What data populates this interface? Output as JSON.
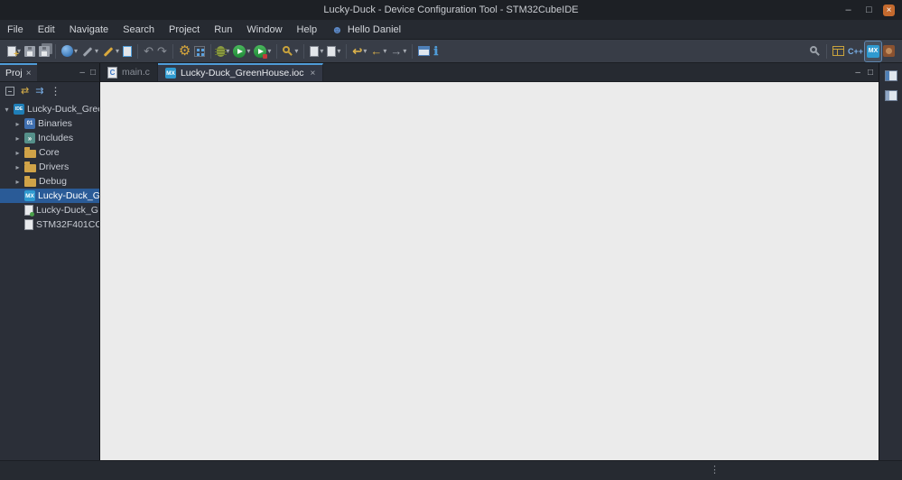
{
  "window": {
    "title": "Lucky-Duck - Device Configuration Tool - STM32CubeIDE"
  },
  "menubar": {
    "items": [
      "File",
      "Edit",
      "Navigate",
      "Search",
      "Project",
      "Run",
      "Window",
      "Help"
    ],
    "user_label": "Hello Daniel"
  },
  "toolbar": {
    "icons": [
      "new-wizard",
      "save",
      "save-all",
      "stm32-target",
      "flash-programmer",
      "build",
      "open-element",
      "undo",
      "redo",
      "device-configuration",
      "chip-programmer",
      "debug",
      "run",
      "external-tools",
      "search",
      "new-header-file",
      "new-source-file",
      "last-edit-location",
      "back",
      "forward",
      "open-window",
      "about-info"
    ],
    "right_icons": [
      "quick-access-search",
      "open-perspective",
      "cpp-perspective",
      "device-config-perspective",
      "debug-perspective"
    ]
  },
  "explorer": {
    "tab_label": "Proj",
    "tree": [
      {
        "label": "Lucky-Duck_Gree"
      },
      {
        "label": "Binaries"
      },
      {
        "label": "Includes"
      },
      {
        "label": "Core"
      },
      {
        "label": "Drivers"
      },
      {
        "label": "Debug"
      },
      {
        "label": "Lucky-Duck_G"
      },
      {
        "label": "Lucky-Duck_G"
      },
      {
        "label": "STM32F401CC"
      }
    ]
  },
  "editor": {
    "tabs": [
      {
        "label": "main.c"
      },
      {
        "label": "Lucky-Duck_GreenHouse.ioc"
      }
    ]
  },
  "glyphs": {
    "dropdown": "▾",
    "expanded": "▾",
    "collapsed": "▸",
    "minimize": "–",
    "maximize": "□",
    "close": "×",
    "gear": "⚙",
    "undo": "↶",
    "redo": "↷",
    "back": "←",
    "forward": "→",
    "last_edit": "↩",
    "info": "ℹ",
    "link_editor": "⇄",
    "focus": "⇉",
    "view_menu": "⋮",
    "grip": "⋮",
    "user": "☻",
    "plus": "+"
  },
  "icon_text": {
    "mx": "MX",
    "ide": "IDE",
    "bin": "01",
    "inc": "»",
    "c": "C",
    "cpp": "C++"
  },
  "colors": {
    "selection": "#2a5b97",
    "accent": "#4f9cd8",
    "editor_bg": "#ebebeb",
    "run_green": "#2f9e44",
    "toolbar_yellow": "#d9a83c",
    "close_orange": "#c46a2e"
  }
}
